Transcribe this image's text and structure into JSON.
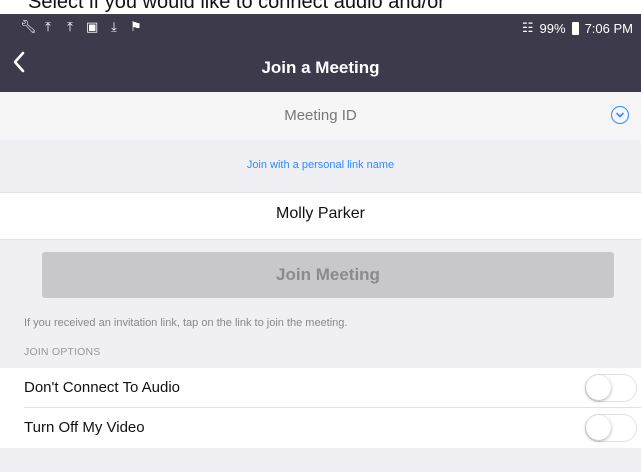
{
  "caption": "Select if you would like to connect audio and/or",
  "status_bar": {
    "left_icons": [
      "wrench-icon",
      "upload-icon",
      "upload-icon",
      "image-icon",
      "download-icon",
      "flag-icon"
    ],
    "battery": "99%",
    "time": "7:06 PM"
  },
  "nav": {
    "back_icon": "chevron-left-icon",
    "title": "Join a Meeting"
  },
  "meeting_id": {
    "placeholder": "Meeting ID",
    "dropdown_icon": "chevron-down-circle-icon"
  },
  "personal_link_label": "Join with a personal link name",
  "name_field": {
    "value": "Molly Parker"
  },
  "join_button": {
    "label": "Join Meeting",
    "enabled": false
  },
  "hint": "If you received an invitation link, tap on the link to join the meeting.",
  "join_options": {
    "header": "JOIN OPTIONS",
    "options": [
      {
        "label": "Don't Connect To Audio",
        "on": false
      },
      {
        "label": "Turn Off My Video",
        "on": false
      }
    ]
  },
  "colors": {
    "nav_background": "#3d3b4b",
    "accent_blue": "#2d8cff",
    "button_disabled": "#c8c8cc",
    "page_background": "#efeff4"
  }
}
